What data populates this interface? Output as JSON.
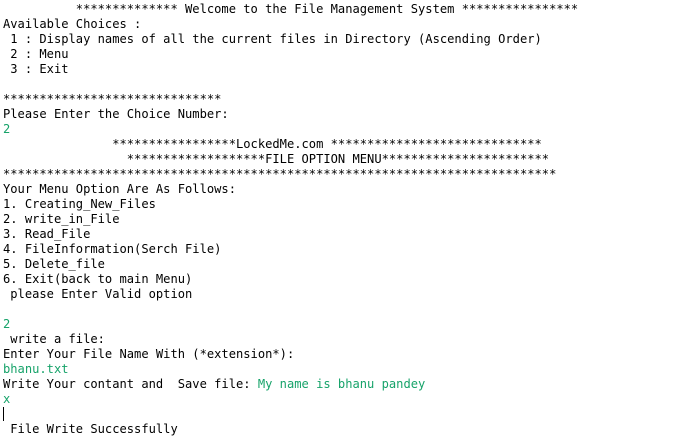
{
  "console": {
    "welcome_banner": "          ************** Welcome to the File Management System ****************",
    "choices_heading": "Available Choices :",
    "choice_1": " 1 : Display names of all the current files in Directory (Ascending Order)",
    "choice_2": " 2 : Menu",
    "choice_3": " 3 : Exit",
    "blank_a": "",
    "separator": "******************************",
    "choice_prompt": "Please Enter the Choice Number:",
    "choice_input": "2",
    "lockedme_banner": "               *****************LockedMe.com *****************************",
    "file_option_banner": "                 *******************FILE OPTION MENU***********************",
    "long_separator": "****************************************************************************",
    "menu_heading": "Your Menu Option Are As Follows:",
    "menu_1": "1. Creating_New_Files",
    "menu_2": "2. write_in_File",
    "menu_3": "3. Read_File",
    "menu_4": "4. FileInformation(Serch File)",
    "menu_5": "5. Delete_file",
    "menu_6": "6. Exit(back to main Menu)",
    "valid_option_prompt": " please Enter Valid option",
    "blank_b": "",
    "option_input": "2",
    "write_file_label": " write a file:",
    "file_name_prompt": "Enter Your File Name With (*extension*):",
    "file_name_input": "bhanu.txt",
    "content_prompt": "Write Your contant and  Save file: ",
    "content_input": "My name is bhanu pandey",
    "save_input": "x",
    "blank_c": "",
    "success_message": " File Write Successfully"
  }
}
